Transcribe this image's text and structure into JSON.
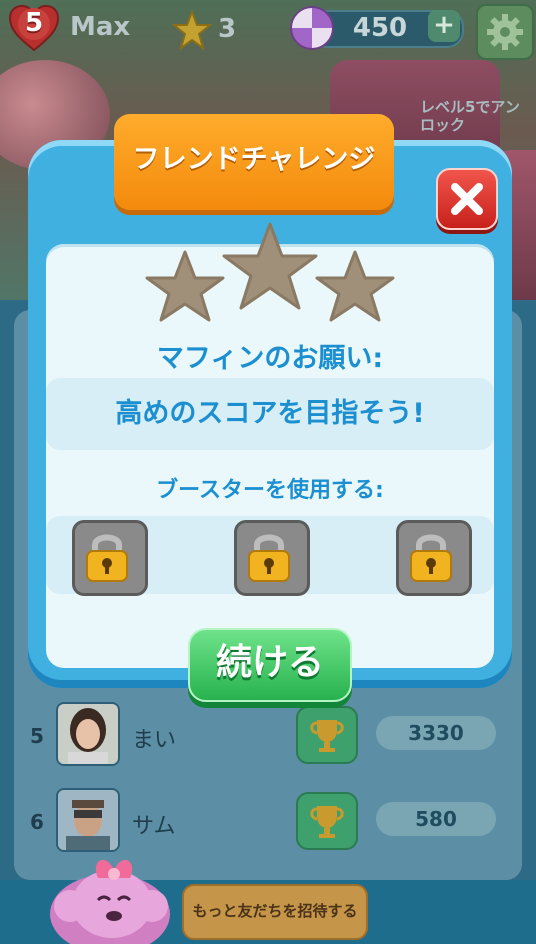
{
  "hud": {
    "level": "5",
    "lives_label": "Max",
    "stars": "3",
    "coins": "450",
    "plus": "+",
    "unlock_text": "レベル5でアンロック"
  },
  "dialog": {
    "title": "フレンドチャレンジ",
    "goal_heading": "マフィンのお願い:",
    "goal_text": "高めのスコアを目指そう!",
    "booster_label": "ブースターを使用する:",
    "continue_label": "続ける",
    "stars_earned": 0,
    "stars_total": 3,
    "boosters": [
      "locked",
      "locked",
      "locked"
    ]
  },
  "leaderboard": {
    "rows": [
      {
        "rank": "5",
        "name": "まい",
        "score": "3330"
      },
      {
        "rank": "6",
        "name": "サム",
        "score": "580"
      }
    ],
    "invite_label": "もっと友だちを招待する"
  },
  "colors": {
    "title_orange": "#f9a126",
    "panel_blue": "#3fb0e0",
    "text_blue": "#1c8fd0",
    "continue_green": "#2fc257",
    "close_red": "#e03a32",
    "star_empty": "#a0907a"
  },
  "icons": [
    "heart-icon",
    "star-icon",
    "candy-icon",
    "plus-icon",
    "gear-icon",
    "close-icon",
    "lock-icon",
    "trophy-icon"
  ]
}
